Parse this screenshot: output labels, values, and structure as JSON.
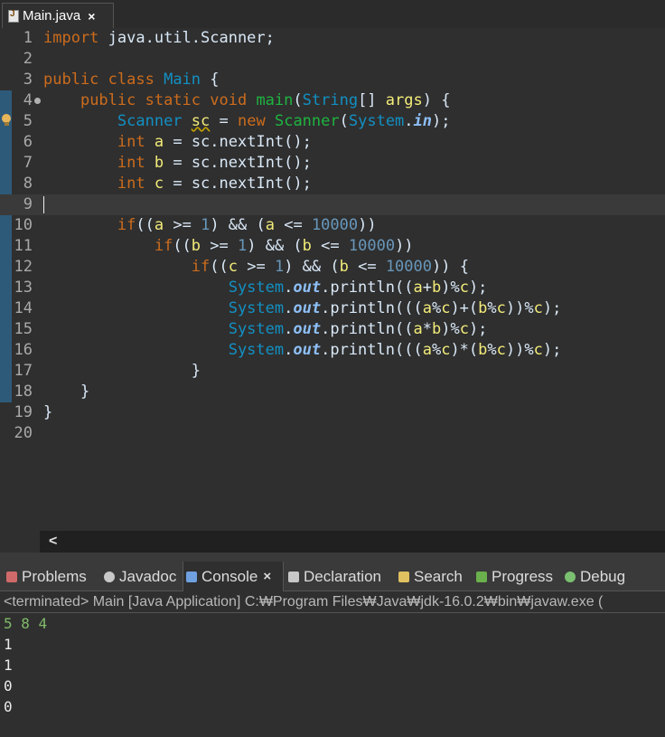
{
  "editor_tab": {
    "title": "Main.java",
    "close": "×"
  },
  "code_lines": [
    {
      "n": "1",
      "tokens": [
        {
          "c": "kw",
          "t": "import"
        },
        {
          "c": "va",
          "t": " java.util.Scanner;"
        }
      ]
    },
    {
      "n": "2",
      "tokens": []
    },
    {
      "n": "3",
      "tokens": [
        {
          "c": "kw",
          "t": "public class"
        },
        {
          "c": "va",
          "t": " "
        },
        {
          "c": "ty",
          "t": "Main"
        },
        {
          "c": "va",
          "t": " {"
        }
      ]
    },
    {
      "n": "4",
      "tokens": [
        {
          "c": "va",
          "t": "    "
        },
        {
          "c": "kw",
          "t": "public static void"
        },
        {
          "c": "va",
          "t": " "
        },
        {
          "c": "fn",
          "t": "main"
        },
        {
          "c": "va",
          "t": "("
        },
        {
          "c": "ty",
          "t": "String"
        },
        {
          "c": "va",
          "t": "[] "
        },
        {
          "c": "vr",
          "t": "args"
        },
        {
          "c": "va",
          "t": ") {"
        }
      ]
    },
    {
      "n": "5",
      "tokens": [
        {
          "c": "va",
          "t": "        "
        },
        {
          "c": "ty",
          "t": "Scanner"
        },
        {
          "c": "va",
          "t": " "
        },
        {
          "c": "vr wavy",
          "t": "sc"
        },
        {
          "c": "va",
          "t": " = "
        },
        {
          "c": "kw",
          "t": "new"
        },
        {
          "c": "va",
          "t": " "
        },
        {
          "c": "fn",
          "t": "Scanner"
        },
        {
          "c": "va",
          "t": "("
        },
        {
          "c": "ty",
          "t": "System"
        },
        {
          "c": "va",
          "t": "."
        },
        {
          "c": "fi",
          "t": "in"
        },
        {
          "c": "va",
          "t": ");"
        }
      ]
    },
    {
      "n": "6",
      "tokens": [
        {
          "c": "va",
          "t": "        "
        },
        {
          "c": "kw",
          "t": "int"
        },
        {
          "c": "va",
          "t": " "
        },
        {
          "c": "vr",
          "t": "a"
        },
        {
          "c": "va",
          "t": " = sc.nextInt();"
        }
      ]
    },
    {
      "n": "7",
      "tokens": [
        {
          "c": "va",
          "t": "        "
        },
        {
          "c": "kw",
          "t": "int"
        },
        {
          "c": "va",
          "t": " "
        },
        {
          "c": "vr",
          "t": "b"
        },
        {
          "c": "va",
          "t": " = sc.nextInt();"
        }
      ]
    },
    {
      "n": "8",
      "tokens": [
        {
          "c": "va",
          "t": "        "
        },
        {
          "c": "kw",
          "t": "int"
        },
        {
          "c": "va",
          "t": " "
        },
        {
          "c": "vr",
          "t": "c"
        },
        {
          "c": "va",
          "t": " = sc.nextInt();"
        }
      ]
    },
    {
      "n": "9",
      "tokens": []
    },
    {
      "n": "10",
      "tokens": [
        {
          "c": "va",
          "t": "        "
        },
        {
          "c": "kw",
          "t": "if"
        },
        {
          "c": "va",
          "t": "(("
        },
        {
          "c": "vr",
          "t": "a"
        },
        {
          "c": "va",
          "t": " >= "
        },
        {
          "c": "nu",
          "t": "1"
        },
        {
          "c": "va",
          "t": ") && ("
        },
        {
          "c": "vr",
          "t": "a"
        },
        {
          "c": "va",
          "t": " <= "
        },
        {
          "c": "nu",
          "t": "10000"
        },
        {
          "c": "va",
          "t": "))"
        }
      ]
    },
    {
      "n": "11",
      "tokens": [
        {
          "c": "va",
          "t": "            "
        },
        {
          "c": "kw",
          "t": "if"
        },
        {
          "c": "va",
          "t": "(("
        },
        {
          "c": "vr",
          "t": "b"
        },
        {
          "c": "va",
          "t": " >= "
        },
        {
          "c": "nu",
          "t": "1"
        },
        {
          "c": "va",
          "t": ") && ("
        },
        {
          "c": "vr",
          "t": "b"
        },
        {
          "c": "va",
          "t": " <= "
        },
        {
          "c": "nu",
          "t": "10000"
        },
        {
          "c": "va",
          "t": "))"
        }
      ]
    },
    {
      "n": "12",
      "tokens": [
        {
          "c": "va",
          "t": "                "
        },
        {
          "c": "kw",
          "t": "if"
        },
        {
          "c": "va",
          "t": "(("
        },
        {
          "c": "vr",
          "t": "c"
        },
        {
          "c": "va",
          "t": " >= "
        },
        {
          "c": "nu",
          "t": "1"
        },
        {
          "c": "va",
          "t": ") && ("
        },
        {
          "c": "vr",
          "t": "b"
        },
        {
          "c": "va",
          "t": " <= "
        },
        {
          "c": "nu",
          "t": "10000"
        },
        {
          "c": "va",
          "t": ")) {"
        }
      ]
    },
    {
      "n": "13",
      "tokens": [
        {
          "c": "va",
          "t": "                    "
        },
        {
          "c": "sc",
          "t": "System"
        },
        {
          "c": "va",
          "t": "."
        },
        {
          "c": "fi",
          "t": "out"
        },
        {
          "c": "va",
          "t": ".println(("
        },
        {
          "c": "vr",
          "t": "a"
        },
        {
          "c": "va",
          "t": "+"
        },
        {
          "c": "vr",
          "t": "b"
        },
        {
          "c": "va",
          "t": ")%"
        },
        {
          "c": "vr",
          "t": "c"
        },
        {
          "c": "va",
          "t": ");"
        }
      ]
    },
    {
      "n": "14",
      "tokens": [
        {
          "c": "va",
          "t": "                    "
        },
        {
          "c": "sc",
          "t": "System"
        },
        {
          "c": "va",
          "t": "."
        },
        {
          "c": "fi",
          "t": "out"
        },
        {
          "c": "va",
          "t": ".println((("
        },
        {
          "c": "vr",
          "t": "a"
        },
        {
          "c": "va",
          "t": "%"
        },
        {
          "c": "vr",
          "t": "c"
        },
        {
          "c": "va",
          "t": ")+("
        },
        {
          "c": "vr",
          "t": "b"
        },
        {
          "c": "va",
          "t": "%"
        },
        {
          "c": "vr",
          "t": "c"
        },
        {
          "c": "va",
          "t": "))%"
        },
        {
          "c": "vr",
          "t": "c"
        },
        {
          "c": "va",
          "t": ");"
        }
      ]
    },
    {
      "n": "15",
      "tokens": [
        {
          "c": "va",
          "t": "                    "
        },
        {
          "c": "sc",
          "t": "System"
        },
        {
          "c": "va",
          "t": "."
        },
        {
          "c": "fi",
          "t": "out"
        },
        {
          "c": "va",
          "t": ".println(("
        },
        {
          "c": "vr",
          "t": "a"
        },
        {
          "c": "va",
          "t": "*"
        },
        {
          "c": "vr",
          "t": "b"
        },
        {
          "c": "va",
          "t": ")%"
        },
        {
          "c": "vr",
          "t": "c"
        },
        {
          "c": "va",
          "t": ");"
        }
      ]
    },
    {
      "n": "16",
      "tokens": [
        {
          "c": "va",
          "t": "                    "
        },
        {
          "c": "sc",
          "t": "System"
        },
        {
          "c": "va",
          "t": "."
        },
        {
          "c": "fi",
          "t": "out"
        },
        {
          "c": "va",
          "t": ".println((("
        },
        {
          "c": "vr",
          "t": "a"
        },
        {
          "c": "va",
          "t": "%"
        },
        {
          "c": "vr",
          "t": "c"
        },
        {
          "c": "va",
          "t": ")*("
        },
        {
          "c": "vr",
          "t": "b"
        },
        {
          "c": "va",
          "t": "%"
        },
        {
          "c": "vr",
          "t": "c"
        },
        {
          "c": "va",
          "t": "))%"
        },
        {
          "c": "vr",
          "t": "c"
        },
        {
          "c": "va",
          "t": ");"
        }
      ]
    },
    {
      "n": "17",
      "tokens": [
        {
          "c": "va",
          "t": "                }"
        }
      ]
    },
    {
      "n": "18",
      "tokens": [
        {
          "c": "va",
          "t": "    }"
        }
      ]
    },
    {
      "n": "19",
      "tokens": [
        {
          "c": "va",
          "t": "}"
        }
      ]
    },
    {
      "n": "20",
      "tokens": []
    }
  ],
  "scroll_arrow": "<",
  "views": [
    {
      "label": "Problems",
      "icon": "problems-icon",
      "color": "#d06a6a"
    },
    {
      "label": "Javadoc",
      "icon": "javadoc-icon",
      "color": "#c8c8c8"
    },
    {
      "label": "Console",
      "icon": "console-icon",
      "color": "#6fa0e0",
      "active": true,
      "close": "×"
    },
    {
      "label": "Declaration",
      "icon": "declaration-icon",
      "color": "#c8c8c8"
    },
    {
      "label": "Search",
      "icon": "search-icon",
      "color": "#e0c060"
    },
    {
      "label": "Progress",
      "icon": "progress-icon",
      "color": "#6ab04c"
    },
    {
      "label": "Debug",
      "icon": "debug-icon",
      "color": "#7ac070"
    }
  ],
  "console": {
    "status": "<terminated> Main [Java Application] C:₩Program Files₩Java₩jdk-16.0.2₩bin₩javaw.exe  (",
    "input": "5 8 4",
    "output": [
      "1",
      "1",
      "0",
      "0"
    ]
  }
}
